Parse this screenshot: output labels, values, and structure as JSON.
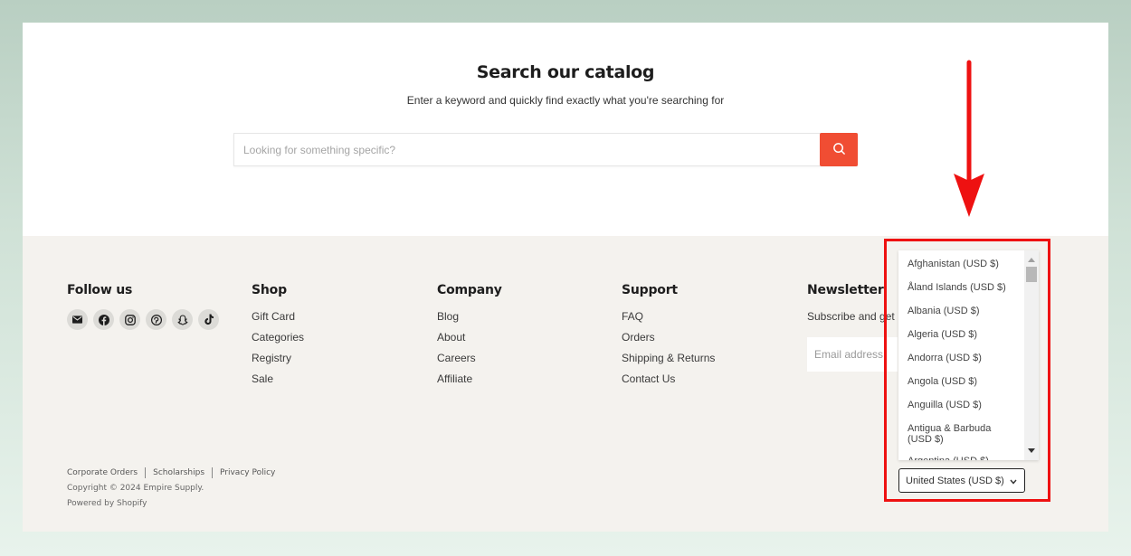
{
  "search": {
    "title": "Search our catalog",
    "subtitle": "Enter a keyword and quickly find exactly what you're searching for",
    "placeholder": "Looking for something specific?",
    "button_icon": "search-icon",
    "accent_color": "#f04d33"
  },
  "footer": {
    "follow_us": {
      "heading": "Follow us",
      "icons": [
        "email-icon",
        "facebook-icon",
        "instagram-icon",
        "pinterest-icon",
        "snapchat-icon",
        "tiktok-icon"
      ]
    },
    "shop": {
      "heading": "Shop",
      "links": [
        "Gift Card",
        "Categories",
        "Registry",
        "Sale"
      ]
    },
    "company": {
      "heading": "Company",
      "links": [
        "Blog",
        "About",
        "Careers",
        "Affiliate"
      ]
    },
    "support": {
      "heading": "Support",
      "links": [
        "FAQ",
        "Orders",
        "Shipping & Returns",
        "Contact Us"
      ]
    },
    "newsletter": {
      "heading": "Newsletter",
      "text": "Subscribe and get :",
      "email_placeholder": "Email address"
    },
    "bottom_links": [
      "Corporate Orders",
      "Scholarships",
      "Privacy Policy"
    ],
    "copyright": "Copyright © 2024 Empire Supply.",
    "powered_by": "Powered by Shopify"
  },
  "country_selector": {
    "selected": "United States (USD $)",
    "options": [
      "Afghanistan (USD $)",
      "Åland Islands (USD $)",
      "Albania (USD $)",
      "Algeria (USD $)",
      "Andorra (USD $)",
      "Angola (USD $)",
      "Anguilla (USD $)",
      "Antigua & Barbuda (USD $)",
      "Argentina (USD $)"
    ]
  },
  "annotation": {
    "highlight_color": "#ee1111"
  }
}
